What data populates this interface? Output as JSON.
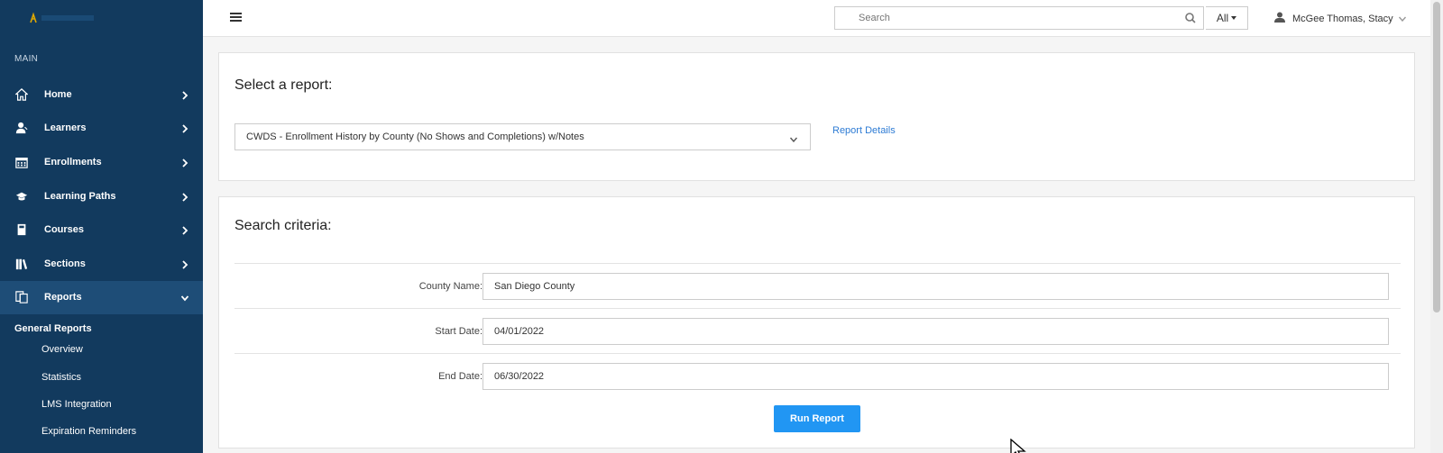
{
  "sidebar": {
    "section_label": "MAIN",
    "items": [
      {
        "label": "Home",
        "icon": "home-icon"
      },
      {
        "label": "Learners",
        "icon": "user-icon"
      },
      {
        "label": "Enrollments",
        "icon": "calendar-icon"
      },
      {
        "label": "Learning Paths",
        "icon": "graduation-cap-icon"
      },
      {
        "label": "Courses",
        "icon": "book-icon"
      },
      {
        "label": "Sections",
        "icon": "books-icon"
      },
      {
        "label": "Reports",
        "icon": "copy-icon"
      }
    ],
    "sub_heading": "General Reports",
    "sub_items": [
      "Overview",
      "Statistics",
      "LMS Integration",
      "Expiration Reminders"
    ]
  },
  "topbar": {
    "search_placeholder": "Search",
    "scope": "All",
    "user_name": "McGee Thomas, Stacy"
  },
  "report_panel": {
    "title": "Select a report:",
    "selected_report": "CWDS - Enrollment History by County (No Shows and Completions) w/Notes",
    "details_link": "Report Details"
  },
  "criteria_panel": {
    "title": "Search criteria:",
    "fields": [
      {
        "label": "County Name:",
        "value": "San Diego County"
      },
      {
        "label": "Start Date:",
        "value": "04/01/2022"
      },
      {
        "label": "End Date:",
        "value": "06/30/2022"
      }
    ],
    "run_button": "Run Report"
  },
  "colors": {
    "sidebar_bg": "#123a5e",
    "sidebar_active": "#1e4d77",
    "primary_button": "#2196f3",
    "link": "#2d7bd4"
  }
}
